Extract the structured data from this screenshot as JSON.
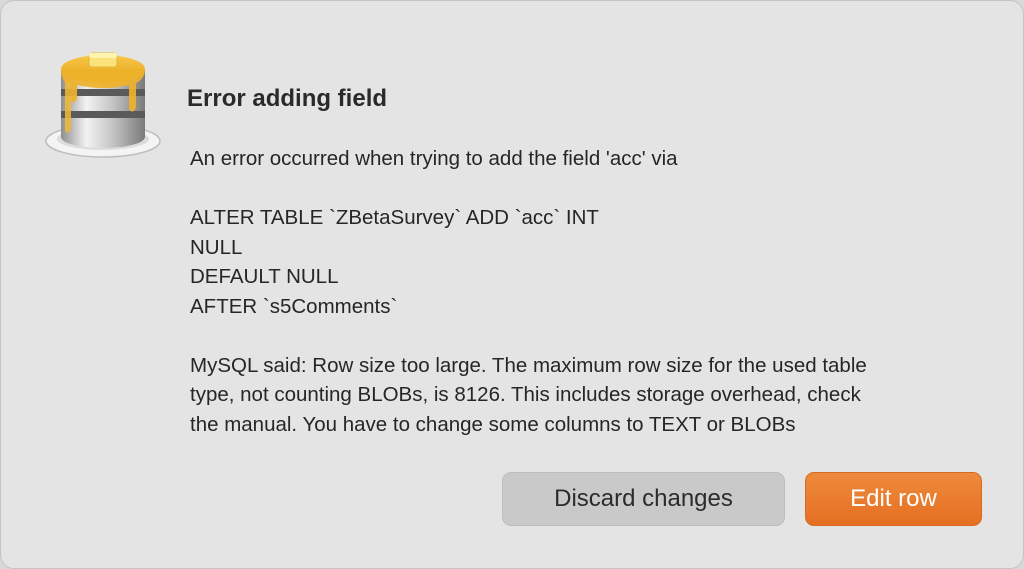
{
  "dialog": {
    "icon": "sequel-pro-pancake-database-icon",
    "title": "Error adding field",
    "message": {
      "intro": "An error occurred when trying to add the field 'acc' via",
      "sql_lines": [
        "ALTER TABLE `ZBetaSurvey` ADD `acc` INT",
        "NULL",
        "DEFAULT NULL",
        "AFTER `s5Comments`"
      ],
      "details_lines": [
        "MySQL said: Row size too large. The maximum row size for the used table",
        "type, not counting BLOBs, is 8126. This includes storage overhead, check",
        "the manual. You have to change some columns to TEXT or BLOBs"
      ]
    },
    "buttons": {
      "discard_label": "Discard changes",
      "edit_label": "Edit row"
    },
    "colors": {
      "accent": "#e97a2c",
      "background": "#e4e4e4",
      "secondary_button": "#c9c9c9"
    }
  }
}
